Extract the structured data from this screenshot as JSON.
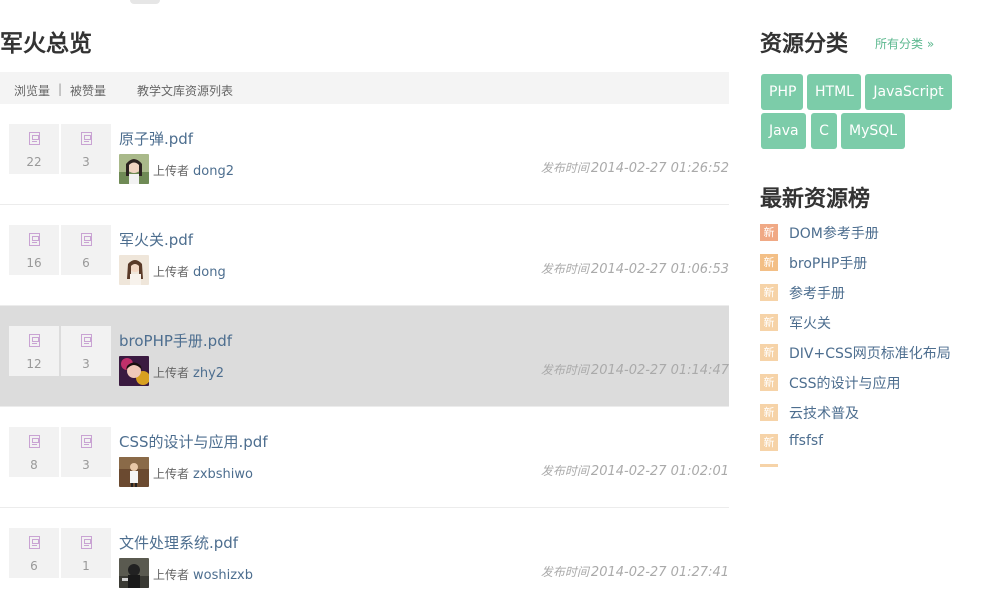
{
  "main": {
    "title": "军火总览",
    "filters": {
      "views": "浏览量",
      "separator": "|",
      "likes": "被赞量",
      "list_title": "教学文库资源列表"
    },
    "uploader_label": "上传者",
    "published_label": "发布时间",
    "resources": [
      {
        "title": "原子弹.pdf",
        "views": "22",
        "likes": "3",
        "uploader": "dong2",
        "time": "2014-02-27 01:26:52",
        "highlighted": false
      },
      {
        "title": "军火关.pdf",
        "views": "16",
        "likes": "6",
        "uploader": "dong",
        "time": "2014-02-27 01:06:53",
        "highlighted": false
      },
      {
        "title": "broPHP手册.pdf",
        "views": "12",
        "likes": "3",
        "uploader": "zhy2",
        "time": "2014-02-27 01:14:47",
        "highlighted": true
      },
      {
        "title": "CSS的设计与应用.pdf",
        "views": "8",
        "likes": "3",
        "uploader": "zxbshiwo",
        "time": "2014-02-27 01:02:01",
        "highlighted": false
      },
      {
        "title": "文件处理系统.pdf",
        "views": "6",
        "likes": "1",
        "uploader": "woshizxb",
        "time": "2014-02-27 01:27:41",
        "highlighted": false
      }
    ]
  },
  "sidebar": {
    "categories_title": "资源分类",
    "all_categories_link": "所有分类 »",
    "tags": [
      "PHP",
      "HTML",
      "JavaScript",
      "Java",
      "C",
      "MySQL"
    ],
    "latest_title": "最新资源榜",
    "new_badge": "新",
    "latest": [
      {
        "label": "DOM参考手册",
        "color": "#f0a985"
      },
      {
        "label": "broPHP手册",
        "color": "#f3bf86"
      },
      {
        "label": "参考手册",
        "color": "#f6d3a8"
      },
      {
        "label": "军火关",
        "color": "#f6d3a8"
      },
      {
        "label": "DIV+CSS网页标准化布局",
        "color": "#f6d3a8"
      },
      {
        "label": "CSS的设计与应用",
        "color": "#f6d3a8"
      },
      {
        "label": "云技术普及",
        "color": "#f6d3a8"
      },
      {
        "label": "ffsfsf",
        "color": "#f6d3a8"
      }
    ]
  }
}
